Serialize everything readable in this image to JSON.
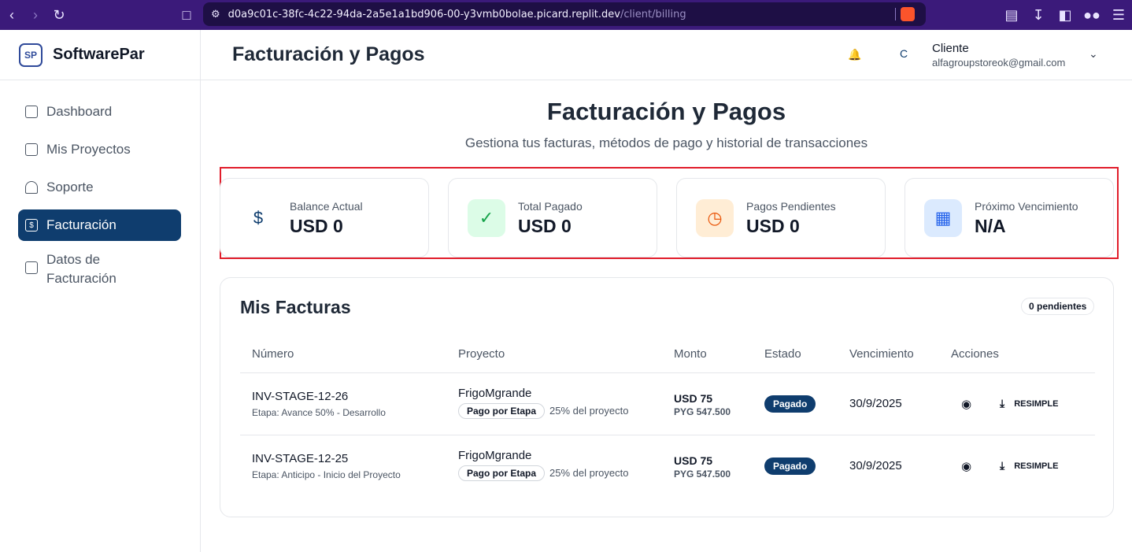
{
  "browser": {
    "url_host": "d0a9c01c-38fc-4c22-94da-2a5e1a1bd906-00-y3vmb0bolae.picard.replit.dev",
    "url_path": "/client/billing"
  },
  "sidebar": {
    "brand": "SoftwarePar",
    "logo_text": "SP",
    "items": [
      {
        "label": "Dashboard",
        "icon": "grid-icon"
      },
      {
        "label": "Mis Proyectos",
        "icon": "folder-icon"
      },
      {
        "label": "Soporte",
        "icon": "headset-icon"
      },
      {
        "label": "Facturación",
        "icon": "receipt-icon",
        "active": true
      },
      {
        "label": "Datos de Facturación",
        "icon": "building-icon"
      }
    ]
  },
  "header": {
    "title": "Facturación y Pagos",
    "avatar_initial": "C",
    "user_name": "Cliente",
    "user_email": "alfagroupstoreok@gmail.com"
  },
  "main": {
    "heading": "Facturación y Pagos",
    "subheading": "Gestiona tus facturas, métodos de pago y historial de transacciones",
    "stats": [
      {
        "label": "Balance Actual",
        "value": "USD 0",
        "icon": "dollar-icon",
        "color": "#0f3d6e"
      },
      {
        "label": "Total Pagado",
        "value": "USD 0",
        "icon": "check-circle-icon",
        "color": "#16a34a"
      },
      {
        "label": "Pagos Pendientes",
        "value": "USD 0",
        "icon": "clock-icon",
        "color": "#ea580c"
      },
      {
        "label": "Próximo Vencimiento",
        "value": "N/A",
        "icon": "calendar-icon",
        "color": "#2563eb"
      }
    ]
  },
  "invoices": {
    "title": "Mis Facturas",
    "pending_badge": "0 pendientes",
    "columns": [
      "Número",
      "Proyecto",
      "Monto",
      "Estado",
      "Vencimiento",
      "Acciones"
    ],
    "rows": [
      {
        "number": "INV-STAGE-12-26",
        "stage": "Etapa: Avance 50% - Desarrollo",
        "project": "FrigoMgrande",
        "payment_type": "Pago por Etapa",
        "percent": "25% del proyecto",
        "amount_usd": "USD 75",
        "amount_pyg": "PYG 547.500",
        "status": "Pagado",
        "due": "30/9/2025",
        "action_label": "RESIMPLE"
      },
      {
        "number": "INV-STAGE-12-25",
        "stage": "Etapa: Anticipo - Inicio del Proyecto",
        "project": "FrigoMgrande",
        "payment_type": "Pago por Etapa",
        "percent": "25% del proyecto",
        "amount_usd": "USD 75",
        "amount_pyg": "PYG 547.500",
        "status": "Pagado",
        "due": "30/9/2025",
        "action_label": "RESIMPLE"
      }
    ]
  }
}
